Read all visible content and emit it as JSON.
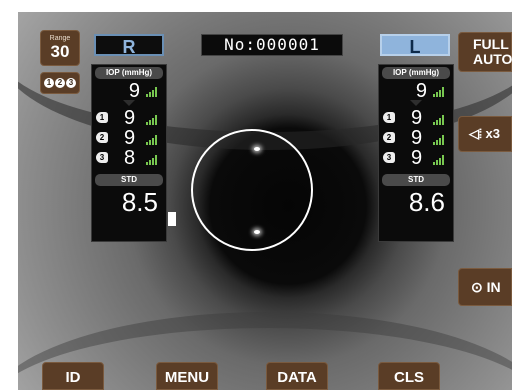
{
  "range": {
    "label": "Range",
    "value": "30"
  },
  "mode": {
    "digits": [
      "1",
      "2",
      "3"
    ]
  },
  "eye_right": {
    "label": "R"
  },
  "eye_left": {
    "label": "L"
  },
  "patient_number": "No:000001",
  "right_panel": {
    "header": "IOP (mmHg)",
    "average": "9",
    "measurements": [
      {
        "index": "1",
        "value": "9"
      },
      {
        "index": "2",
        "value": "9"
      },
      {
        "index": "3",
        "value": "8"
      }
    ],
    "std_label": "STD",
    "std_value": "8.5"
  },
  "left_panel": {
    "header": "IOP (mmHg)",
    "average": "9",
    "measurements": [
      {
        "index": "1",
        "value": "9"
      },
      {
        "index": "2",
        "value": "9"
      },
      {
        "index": "3",
        "value": "9"
      }
    ],
    "std_label": "STD",
    "std_value": "8.6"
  },
  "side_buttons": {
    "full_auto_line1": "FULL",
    "full_auto_line2": "AUTO",
    "volume_symbol": "◁⦙",
    "volume_label": "x3",
    "in_symbol": "⊙",
    "in_label": "IN"
  },
  "bottom_buttons": {
    "id": "ID",
    "menu": "MENU",
    "data": "DATA",
    "cls": "CLS"
  },
  "colors": {
    "button_brown": "#5a3d26",
    "signal_green": "#78c850",
    "eye_blue": "#8fb4dc"
  }
}
